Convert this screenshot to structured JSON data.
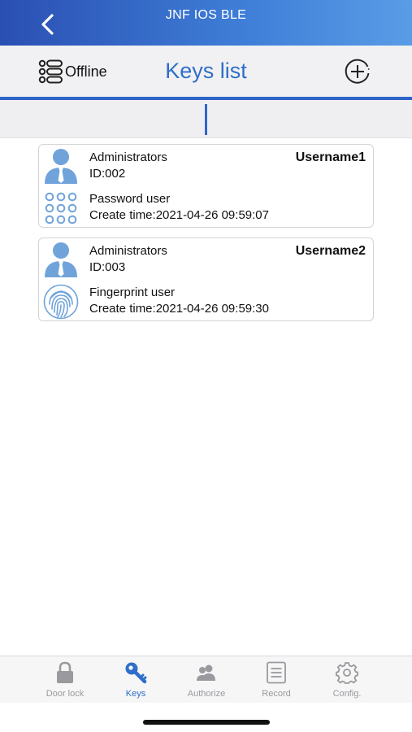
{
  "navbar": {
    "title": "JNF IOS BLE"
  },
  "toolbar": {
    "offline_label": "Offline",
    "heading": "Keys list"
  },
  "keys": [
    {
      "role": "Administrators",
      "id": "ID:002",
      "username": "Username1",
      "kind": "Password user",
      "created": "Create time:2021-04-26 09:59:07",
      "type_icon": "keypad-icon"
    },
    {
      "role": "Administrators",
      "id": "ID:003",
      "username": "Username2",
      "kind": "Fingerprint user",
      "created": "Create time:2021-04-26 09:59:30",
      "type_icon": "fingerprint-icon"
    }
  ],
  "tabs": [
    {
      "label": "Door lock",
      "icon": "lock-icon",
      "active": false
    },
    {
      "label": "Keys",
      "icon": "key-icon",
      "active": true
    },
    {
      "label": "Authorize",
      "icon": "users-icon",
      "active": false
    },
    {
      "label": "Record",
      "icon": "document-icon",
      "active": false
    },
    {
      "label": "Config.",
      "icon": "gear-icon",
      "active": false
    }
  ],
  "colors": {
    "accent": "#2f6fc9",
    "avatar": "#6fa3da",
    "inactive": "#9a9a9e"
  }
}
